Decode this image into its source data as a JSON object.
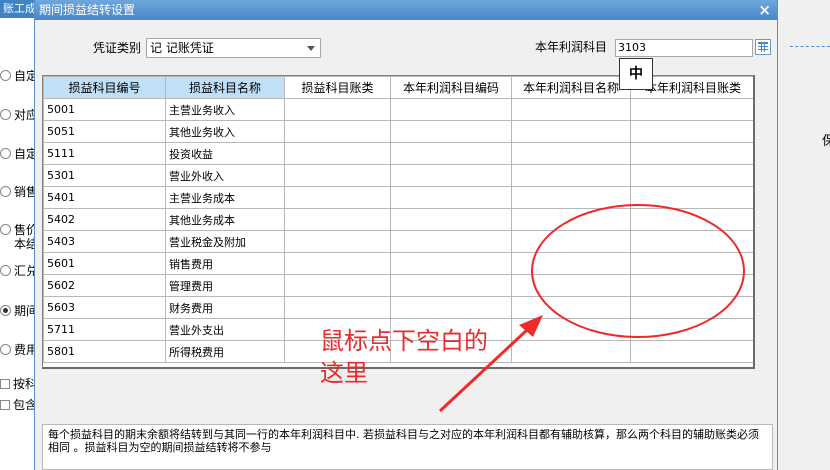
{
  "background": {
    "tab_label": "账工成",
    "options": [
      {
        "label": "自定",
        "type": "radio",
        "checked": false
      },
      {
        "label": "对应",
        "type": "radio",
        "checked": false
      },
      {
        "label": "自定",
        "type": "radio",
        "checked": false
      },
      {
        "label": "销售",
        "type": "radio",
        "checked": false
      },
      {
        "label": "售价",
        "type": "radio",
        "checked": false
      },
      {
        "label": "本结",
        "type": "text",
        "checked": false
      },
      {
        "label": "汇兑",
        "type": "radio",
        "checked": false
      },
      {
        "label": "期间",
        "type": "radio",
        "checked": true
      },
      {
        "label": "费用",
        "type": "radio",
        "checked": false
      },
      {
        "label": "按科",
        "type": "checkbox",
        "checked": false
      },
      {
        "label": "包含",
        "type": "checkbox",
        "checked": false
      }
    ],
    "right_text": "保"
  },
  "dialog": {
    "title": "期间损益结转设置",
    "close_glyph": "×",
    "voucher_type_label": "凭证类别",
    "voucher_type_value": "记 记账凭证",
    "profit_account_label": "本年利润科目",
    "profit_account_value": "3103",
    "ime_indicator": "中",
    "columns": [
      "损益科目编号",
      "损益科目名称",
      "损益科目账类",
      "本年利润科目编码",
      "本年利润科目名称",
      "本年利润科目账类"
    ],
    "rows": [
      {
        "code": "5001",
        "name": "主营业务收入",
        "type": "",
        "profit_code": "",
        "profit_name": "",
        "profit_type": ""
      },
      {
        "code": "5051",
        "name": "其他业务收入",
        "type": "",
        "profit_code": "",
        "profit_name": "",
        "profit_type": ""
      },
      {
        "code": "5111",
        "name": "投资收益",
        "type": "",
        "profit_code": "",
        "profit_name": "",
        "profit_type": ""
      },
      {
        "code": "5301",
        "name": "营业外收入",
        "type": "",
        "profit_code": "",
        "profit_name": "",
        "profit_type": ""
      },
      {
        "code": "5401",
        "name": "主营业务成本",
        "type": "",
        "profit_code": "",
        "profit_name": "",
        "profit_type": ""
      },
      {
        "code": "5402",
        "name": "其他业务成本",
        "type": "",
        "profit_code": "",
        "profit_name": "",
        "profit_type": ""
      },
      {
        "code": "5403",
        "name": "营业税金及附加",
        "type": "",
        "profit_code": "",
        "profit_name": "",
        "profit_type": ""
      },
      {
        "code": "5601",
        "name": "销售费用",
        "type": "",
        "profit_code": "",
        "profit_name": "",
        "profit_type": ""
      },
      {
        "code": "5602",
        "name": "管理费用",
        "type": "",
        "profit_code": "",
        "profit_name": "",
        "profit_type": ""
      },
      {
        "code": "5603",
        "name": "财务费用",
        "type": "",
        "profit_code": "",
        "profit_name": "",
        "profit_type": ""
      },
      {
        "code": "5711",
        "name": "营业外支出",
        "type": "",
        "profit_code": "",
        "profit_name": "",
        "profit_type": ""
      },
      {
        "code": "5801",
        "name": "所得税费用",
        "type": "",
        "profit_code": "",
        "profit_name": "",
        "profit_type": ""
      }
    ],
    "info_text": "每个损益科目的期末余额将结转到与其同一行的本年利润科目中. 若损益科目与之对应的本年利润科目都有辅助核算，那么两个科目的辅助账类必须相同 。损益科目为空的期间损益结转将不参与"
  },
  "annotation": {
    "line1": "鼠标点下空白的",
    "line2": "这里",
    "color": "#ee2a2a"
  }
}
